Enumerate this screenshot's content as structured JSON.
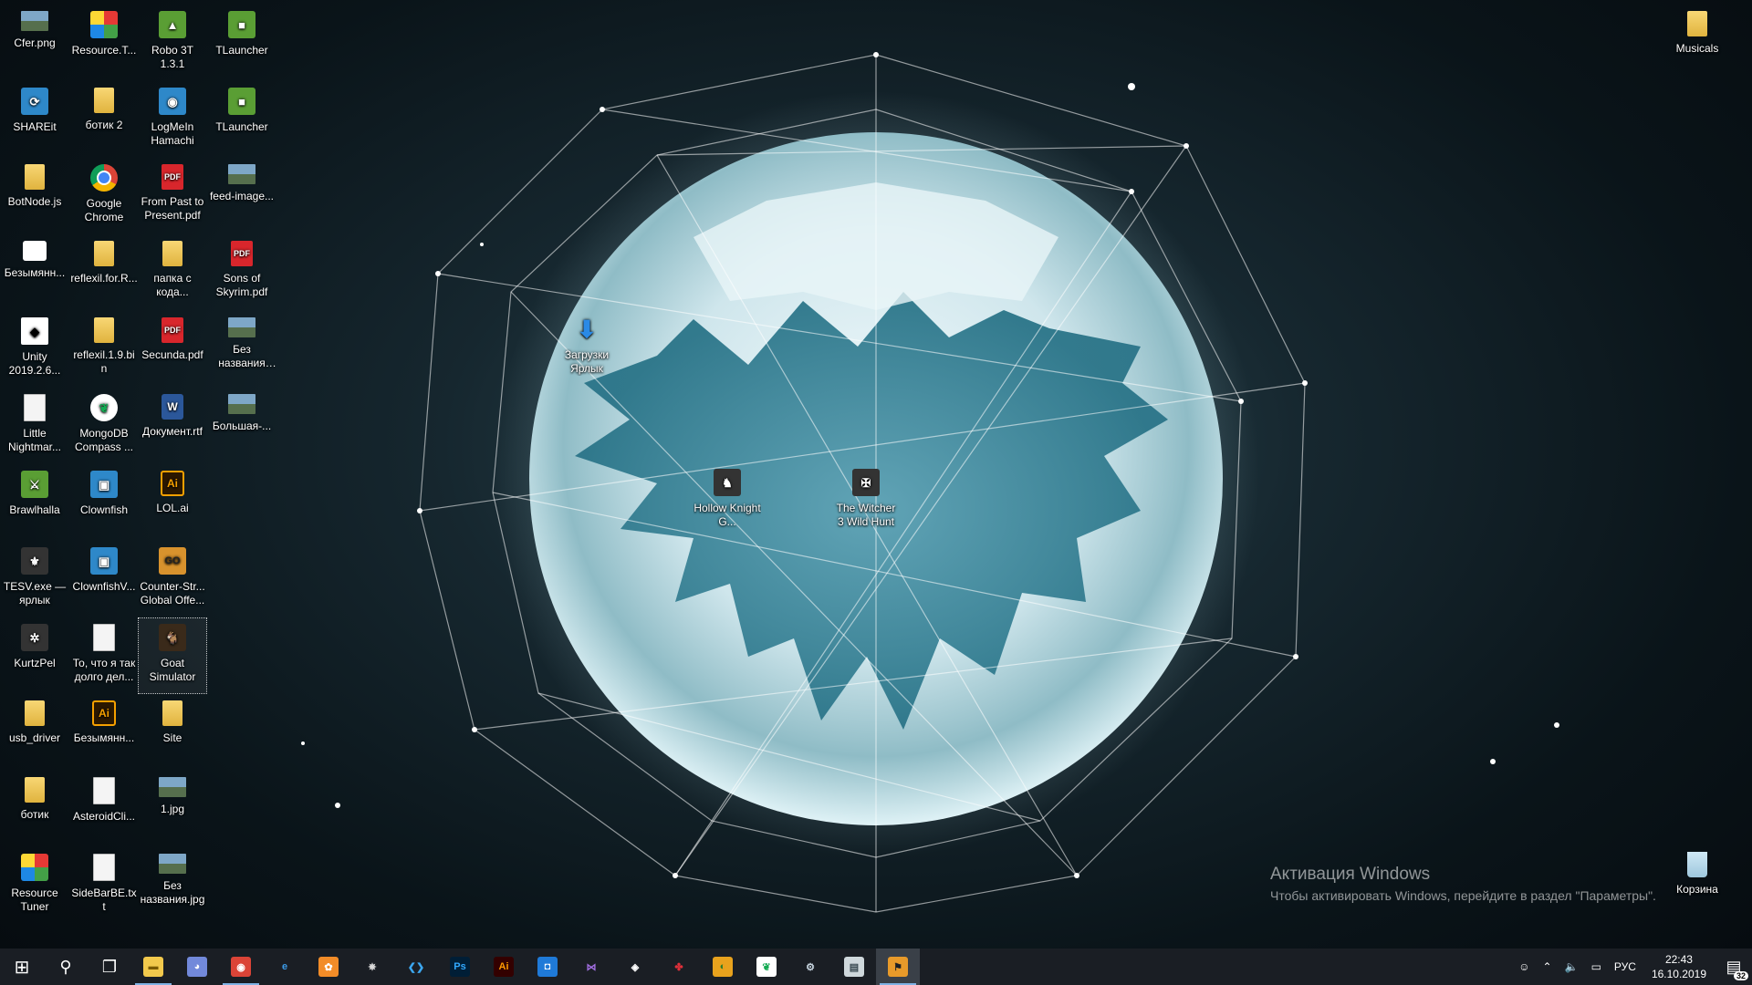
{
  "desktop": {
    "col1": [
      {
        "label": "Cfer.png",
        "icon": "image-icon",
        "style": "img"
      },
      {
        "label": "SHAREit",
        "icon": "shareit-icon",
        "style": "app",
        "glyph": "⟳"
      },
      {
        "label": "BotNode.js",
        "icon": "archive-icon",
        "style": "folder"
      },
      {
        "label": "Безымянн...",
        "icon": "blank-image-icon",
        "style": "white"
      },
      {
        "label": "Unity 2019.2.6...",
        "icon": "unity-icon",
        "style": "unity",
        "glyph": "◆"
      },
      {
        "label": "Little Nightmar...",
        "icon": "document-icon",
        "style": "file"
      },
      {
        "label": "Brawlhalla",
        "icon": "brawlhalla-icon",
        "style": "green",
        "glyph": "⚔"
      },
      {
        "label": "TESV.exe — ярлык",
        "icon": "skyrim-icon",
        "style": "dark",
        "glyph": "⚜"
      },
      {
        "label": "KurtzPel",
        "icon": "kurtzpel-icon",
        "style": "dark",
        "glyph": "✲"
      },
      {
        "label": "usb_driver",
        "icon": "folder-icon",
        "style": "folder"
      },
      {
        "label": "ботик",
        "icon": "archive-icon",
        "style": "folder"
      },
      {
        "label": "Resource Tuner",
        "icon": "resource-tuner-icon",
        "style": "tuner"
      }
    ],
    "col2": [
      {
        "label": "Resource.T...",
        "icon": "resource-tuner-icon",
        "style": "tuner"
      },
      {
        "label": "ботик 2",
        "icon": "folder-icon",
        "style": "folder"
      },
      {
        "label": "Google Chrome",
        "icon": "chrome-icon",
        "style": "chrome"
      },
      {
        "label": "reflexil.for.R...",
        "icon": "folder-icon",
        "style": "folder"
      },
      {
        "label": "reflexil.1.9.bin",
        "icon": "folder-icon",
        "style": "folder"
      },
      {
        "label": "MongoDB Compass ...",
        "icon": "mongodb-icon",
        "style": "mongo",
        "glyph": "❦"
      },
      {
        "label": "Clownfish",
        "icon": "clownfish-icon",
        "style": "app",
        "glyph": "▣"
      },
      {
        "label": "ClownfishV...",
        "icon": "clownfish-icon",
        "style": "app",
        "glyph": "▣"
      },
      {
        "label": "То, что я так долго дел...",
        "icon": "text-file-icon",
        "style": "file"
      },
      {
        "label": "Безымянн...",
        "icon": "illustrator-icon",
        "style": "ai",
        "glyph": "Ai"
      },
      {
        "label": "AsteroidCli...",
        "icon": "text-file-icon",
        "style": "file"
      },
      {
        "label": "SideBarBE.txt",
        "icon": "text-file-icon",
        "style": "file"
      }
    ],
    "col3": [
      {
        "label": "Robo 3T 1.3.1",
        "icon": "robo3t-icon",
        "style": "green",
        "glyph": "▲"
      },
      {
        "label": "LogMeIn Hamachi",
        "icon": "hamachi-icon",
        "style": "app",
        "glyph": "◉"
      },
      {
        "label": "From Past to Present.pdf",
        "icon": "pdf-icon",
        "style": "pdf",
        "glyph": "PDF"
      },
      {
        "label": "папка с кода...",
        "icon": "chrome-folder-icon",
        "style": "folder"
      },
      {
        "label": "Secunda.pdf",
        "icon": "pdf-icon",
        "style": "pdf",
        "glyph": "PDF"
      },
      {
        "label": "Документ.rtf",
        "icon": "word-icon",
        "style": "word",
        "glyph": "W"
      },
      {
        "label": "LOL.ai",
        "icon": "illustrator-icon",
        "style": "ai",
        "glyph": "Ai"
      },
      {
        "label": "Counter-Str... Global Offe...",
        "icon": "csgo-icon",
        "style": "csgo",
        "glyph": "GO"
      },
      {
        "label": "Goat Simulator",
        "icon": "goat-icon",
        "style": "game",
        "glyph": "🐐",
        "selected": true
      },
      {
        "label": "Site",
        "icon": "folder-icon",
        "style": "folder"
      },
      {
        "label": "1.jpg",
        "icon": "image-icon",
        "style": "img"
      },
      {
        "label": "Без названия.jpg",
        "icon": "image-icon",
        "style": "img"
      }
    ],
    "col4": [
      {
        "label": "TLauncher",
        "icon": "tlauncher-icon",
        "style": "green",
        "glyph": "■"
      },
      {
        "label": "TLauncher",
        "icon": "tlauncher-icon",
        "style": "green",
        "glyph": "■"
      },
      {
        "label": "feed-image...",
        "icon": "image-icon",
        "style": "img"
      },
      {
        "label": "Sons of Skyrim.pdf",
        "icon": "pdf-icon",
        "style": "pdf",
        "glyph": "PDF"
      },
      {
        "label": "Без названия (1).jpg",
        "icon": "image-icon",
        "style": "img"
      },
      {
        "label": "Большая-...",
        "icon": "image-icon",
        "style": "img"
      }
    ],
    "floating": [
      {
        "label": "Загрузки Ярлык",
        "icon": "downloads-icon",
        "style": "dl",
        "glyph": "⬇"
      },
      {
        "label": "Hollow Knight G...",
        "icon": "hollow-knight-icon",
        "style": "dark",
        "glyph": "♞"
      },
      {
        "label": "The Witcher 3 Wild Hunt",
        "icon": "witcher-icon",
        "style": "dark",
        "glyph": "✠"
      }
    ],
    "right": [
      {
        "label": "Musicals",
        "icon": "folder-icon",
        "style": "folder"
      },
      {
        "label": "Корзина",
        "icon": "recycle-bin-icon",
        "style": "bin"
      }
    ]
  },
  "activation": {
    "title": "Активация Windows",
    "subtitle": "Чтобы активировать Windows, перейдите в раздел \"Параметры\"."
  },
  "taskbar": {
    "start": {
      "icon": "windows-start-icon",
      "glyph": "⊞"
    },
    "search": {
      "icon": "search-icon",
      "glyph": "⚲"
    },
    "taskview": {
      "icon": "task-view-icon",
      "glyph": "❐"
    },
    "apps": [
      {
        "name": "taskbar-explorer",
        "icon": "file-explorer-icon",
        "bg": "#f2c94c",
        "fg": "#7a5a00",
        "glyph": "▬",
        "open": true
      },
      {
        "name": "taskbar-discord",
        "icon": "discord-icon",
        "bg": "#7289da",
        "fg": "#fff",
        "glyph": "◕"
      },
      {
        "name": "taskbar-chrome",
        "icon": "chrome-icon",
        "bg": "#db4437",
        "fg": "#fff",
        "glyph": "◉",
        "open": true
      },
      {
        "name": "taskbar-edge",
        "icon": "edge-icon",
        "bg": "#1a1e24",
        "fg": "#3c9be8",
        "glyph": "e"
      },
      {
        "name": "taskbar-fl-studio",
        "icon": "fl-studio-icon",
        "bg": "#f28c28",
        "fg": "#fff",
        "glyph": "✿"
      },
      {
        "name": "taskbar-app-spider",
        "icon": "spider-app-icon",
        "bg": "#1a1e24",
        "fg": "#ddd",
        "glyph": "✵"
      },
      {
        "name": "taskbar-vscode",
        "icon": "vscode-icon",
        "bg": "#1a1e24",
        "fg": "#3ca7f0",
        "glyph": "❮❯"
      },
      {
        "name": "taskbar-photoshop",
        "icon": "photoshop-icon",
        "bg": "#001e36",
        "fg": "#31a8ff",
        "glyph": "Ps"
      },
      {
        "name": "taskbar-illustrator",
        "icon": "illustrator-icon",
        "bg": "#330000",
        "fg": "#ff9a00",
        "glyph": "Ai"
      },
      {
        "name": "taskbar-app-blue",
        "icon": "blue-app-icon",
        "bg": "#1f7ad8",
        "fg": "#fff",
        "glyph": "◘"
      },
      {
        "name": "taskbar-visual-studio",
        "icon": "visual-studio-icon",
        "bg": "#1a1e24",
        "fg": "#a16ee0",
        "glyph": "⋈"
      },
      {
        "name": "taskbar-unity",
        "icon": "unity-icon",
        "bg": "#1a1e24",
        "fg": "#fff",
        "glyph": "◈"
      },
      {
        "name": "taskbar-app-red",
        "icon": "red-app-icon",
        "bg": "#1a1e24",
        "fg": "#e0303a",
        "glyph": "✤"
      },
      {
        "name": "taskbar-app-rainbow",
        "icon": "rainbow-app-icon",
        "bg": "#e8a21d",
        "fg": "#2a7a2a",
        "glyph": "◐"
      },
      {
        "name": "taskbar-mongodb",
        "icon": "mongodb-icon",
        "bg": "#fff",
        "fg": "#13aa52",
        "glyph": "❦"
      },
      {
        "name": "taskbar-steam",
        "icon": "steam-icon",
        "bg": "#1a1e24",
        "fg": "#c7d5e0",
        "glyph": "⚙"
      },
      {
        "name": "taskbar-app-window",
        "icon": "window-app-icon",
        "bg": "#cfd8dc",
        "fg": "#37474f",
        "glyph": "▤"
      },
      {
        "name": "taskbar-app-orange",
        "icon": "orange-app-icon",
        "bg": "#e89a2a",
        "fg": "#1a1e24",
        "glyph": "⚑",
        "open": true,
        "active": true
      }
    ]
  },
  "tray": {
    "people_icon": "people-icon",
    "chevron_icon": "chevron-up-icon",
    "volume_icon": "volume-icon",
    "network_icon": "network-icon",
    "language": "РУС",
    "time": "22:43",
    "date": "16.10.2019",
    "notifications_icon": "action-center-icon",
    "notifications_count": "32"
  }
}
